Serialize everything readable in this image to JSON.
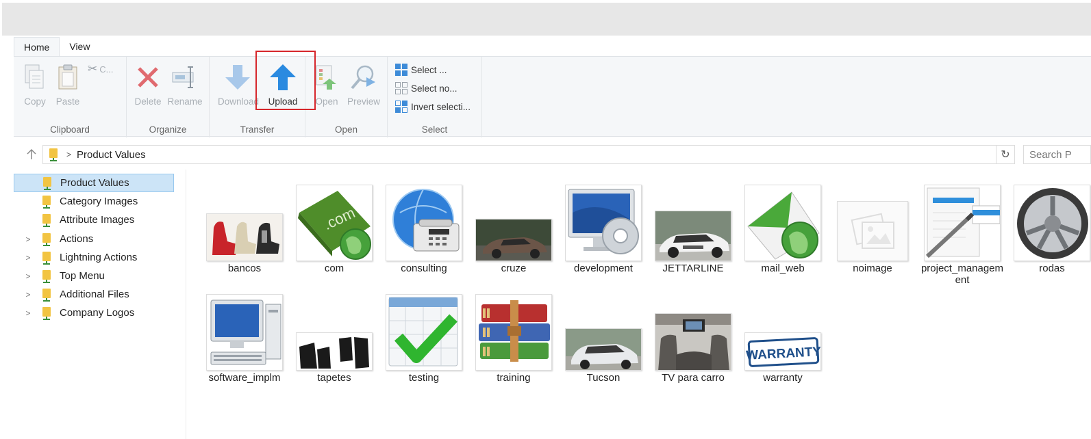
{
  "tabs": [
    {
      "label": "Home"
    },
    {
      "label": "View"
    }
  ],
  "ribbon": {
    "clipboard": {
      "label": "Clipboard",
      "copy": "Copy",
      "paste": "Paste",
      "cut": "C..."
    },
    "organize": {
      "label": "Organize",
      "delete": "Delete",
      "rename": "Rename"
    },
    "transfer": {
      "label": "Transfer",
      "download": "Download",
      "upload": "Upload"
    },
    "open": {
      "label": "Open",
      "open": "Open",
      "preview": "Preview"
    },
    "select": {
      "label": "Select",
      "select_all": "Select ...",
      "select_none": "Select no...",
      "invert": "Invert selecti..."
    }
  },
  "address": {
    "path": "Product Values",
    "search_placeholder": "Search P"
  },
  "sidebar": {
    "items": [
      {
        "label": "Product Values"
      },
      {
        "label": "Category Images"
      },
      {
        "label": "Attribute Images"
      },
      {
        "label": "Actions"
      },
      {
        "label": "Lightning Actions"
      },
      {
        "label": "Top Menu"
      },
      {
        "label": "Additional Files"
      },
      {
        "label": "Company Logos"
      }
    ]
  },
  "files": [
    {
      "name": "bancos",
      "icon": "car-seats-icon"
    },
    {
      "name": "com",
      "icon": "dot-com-folder-icon"
    },
    {
      "name": "consulting",
      "icon": "globe-phone-icon"
    },
    {
      "name": "cruze",
      "icon": "car-photo-icon"
    },
    {
      "name": "development",
      "icon": "monitor-gear-icon"
    },
    {
      "name": "JETTARLINE",
      "icon": "car-photo-icon"
    },
    {
      "name": "mail_web",
      "icon": "mail-globe-icon"
    },
    {
      "name": "noimage",
      "icon": "placeholder-image-icon"
    },
    {
      "name": "project_management",
      "icon": "document-pen-icon"
    },
    {
      "name": "rodas",
      "icon": "wheel-rim-icon"
    },
    {
      "name": "software_implm",
      "icon": "computer-icon"
    },
    {
      "name": "tapetes",
      "icon": "car-mats-icon"
    },
    {
      "name": "testing",
      "icon": "calendar-check-icon"
    },
    {
      "name": "training",
      "icon": "books-icon"
    },
    {
      "name": "Tucson",
      "icon": "suv-photo-icon"
    },
    {
      "name": "TV para carro",
      "icon": "car-interior-icon"
    },
    {
      "name": "warranty",
      "icon": "warranty-stamp-icon"
    }
  ]
}
